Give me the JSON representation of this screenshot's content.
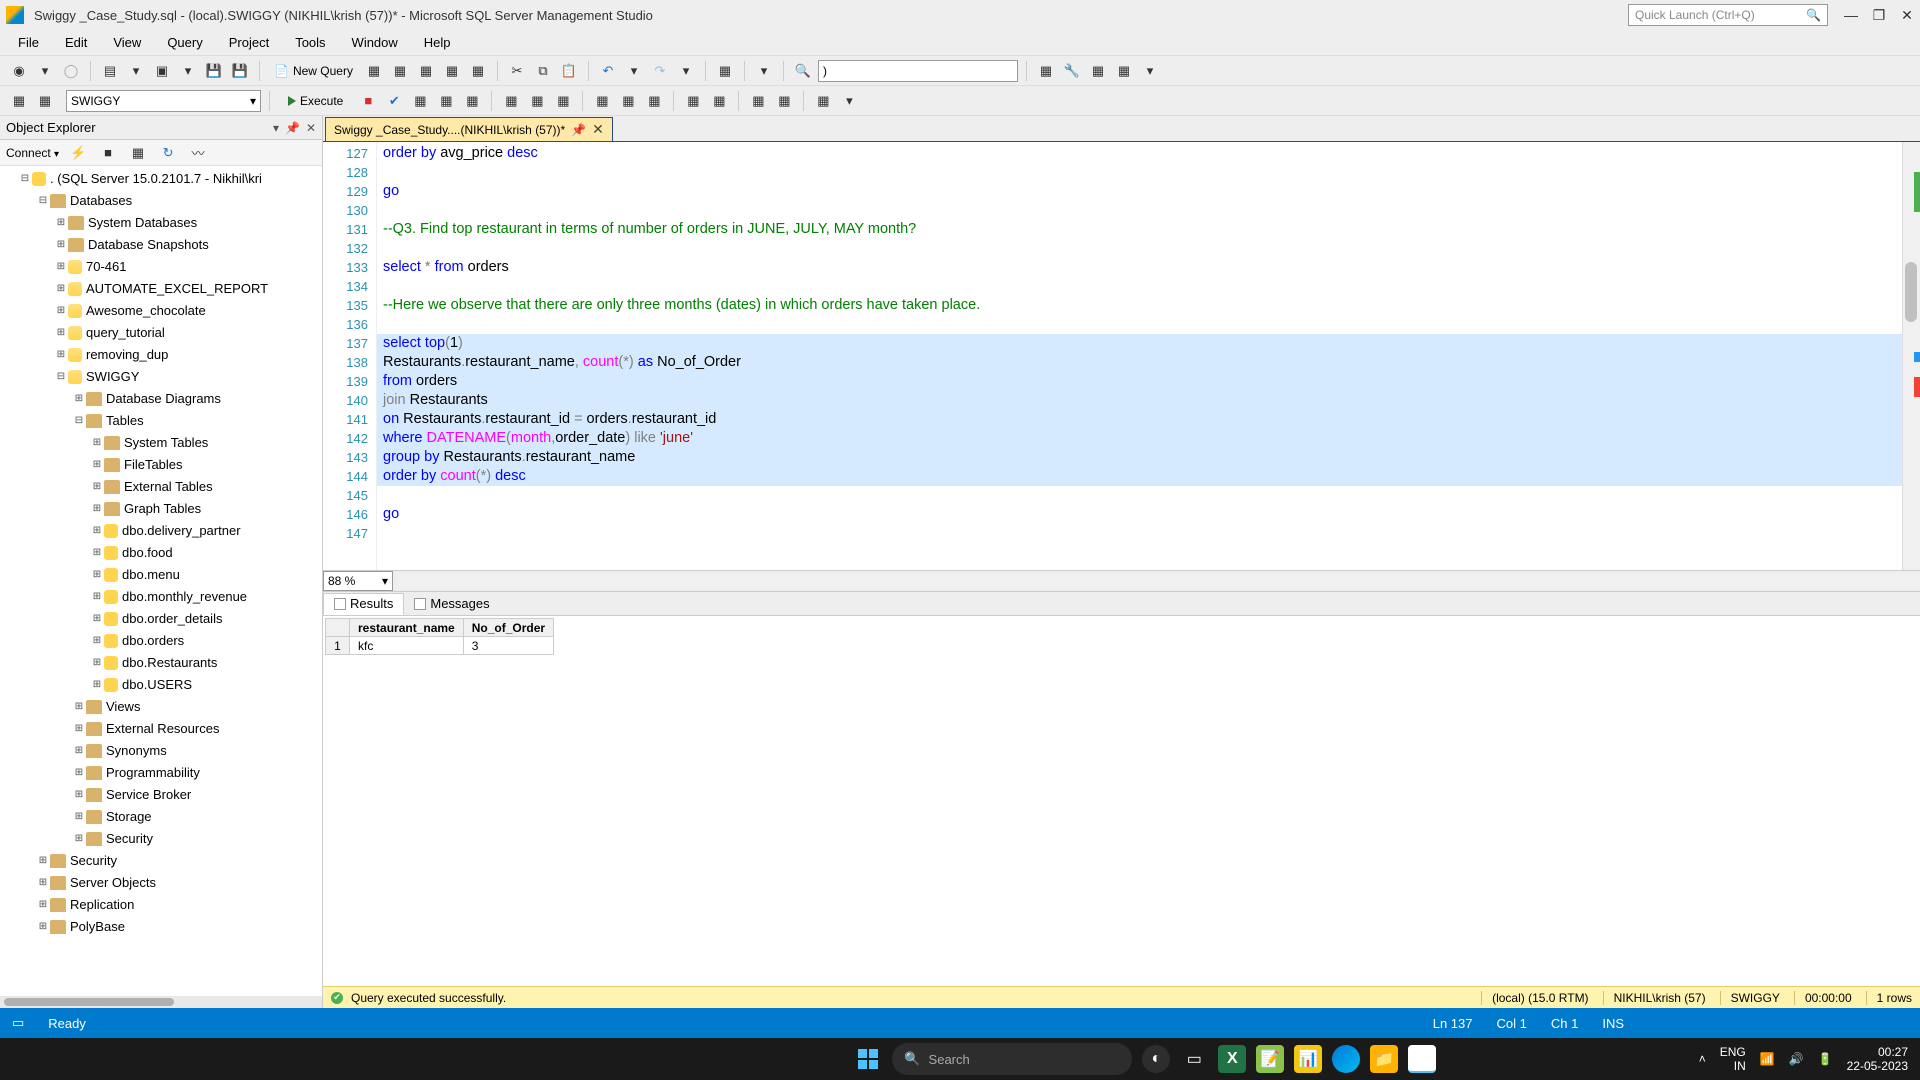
{
  "titlebar": {
    "text": "Swiggy _Case_Study.sql - (local).SWIGGY (NIKHIL\\krish (57))* - Microsoft SQL Server Management Studio",
    "quick_launch_placeholder": "Quick Launch (Ctrl+Q)"
  },
  "menu": [
    "File",
    "Edit",
    "View",
    "Query",
    "Project",
    "Tools",
    "Window",
    "Help"
  ],
  "toolbar": {
    "new_query": "New Query",
    "db": "SWIGGY",
    "execute": "Execute",
    "search_value": ")",
    "zoom": "88 %"
  },
  "object_explorer": {
    "title": "Object Explorer",
    "connect": "Connect",
    "tree": [
      {
        "depth": 0,
        "exp": "-",
        "icon": "db",
        "label": ". (SQL Server 15.0.2101.7 - Nikhil\\kri"
      },
      {
        "depth": 1,
        "exp": "-",
        "icon": "folder",
        "label": "Databases"
      },
      {
        "depth": 2,
        "exp": "+",
        "icon": "folder",
        "label": "System Databases"
      },
      {
        "depth": 2,
        "exp": "+",
        "icon": "folder",
        "label": "Database Snapshots"
      },
      {
        "depth": 2,
        "exp": "+",
        "icon": "cyl",
        "label": "70-461"
      },
      {
        "depth": 2,
        "exp": "+",
        "icon": "cyl",
        "label": "AUTOMATE_EXCEL_REPORT"
      },
      {
        "depth": 2,
        "exp": "+",
        "icon": "cyl",
        "label": "Awesome_chocolate"
      },
      {
        "depth": 2,
        "exp": "+",
        "icon": "cyl",
        "label": "query_tutorial"
      },
      {
        "depth": 2,
        "exp": "+",
        "icon": "cyl",
        "label": "removing_dup"
      },
      {
        "depth": 2,
        "exp": "-",
        "icon": "cyl",
        "label": "SWIGGY"
      },
      {
        "depth": 3,
        "exp": "+",
        "icon": "folder",
        "label": "Database Diagrams"
      },
      {
        "depth": 3,
        "exp": "-",
        "icon": "folder",
        "label": "Tables"
      },
      {
        "depth": 4,
        "exp": "+",
        "icon": "folder",
        "label": "System Tables"
      },
      {
        "depth": 4,
        "exp": "+",
        "icon": "folder",
        "label": "FileTables"
      },
      {
        "depth": 4,
        "exp": "+",
        "icon": "folder",
        "label": "External Tables"
      },
      {
        "depth": 4,
        "exp": "+",
        "icon": "folder",
        "label": "Graph Tables"
      },
      {
        "depth": 4,
        "exp": "+",
        "icon": "table",
        "label": "dbo.delivery_partner"
      },
      {
        "depth": 4,
        "exp": "+",
        "icon": "table",
        "label": "dbo.food"
      },
      {
        "depth": 4,
        "exp": "+",
        "icon": "table",
        "label": "dbo.menu"
      },
      {
        "depth": 4,
        "exp": "+",
        "icon": "table",
        "label": "dbo.monthly_revenue"
      },
      {
        "depth": 4,
        "exp": "+",
        "icon": "table",
        "label": "dbo.order_details"
      },
      {
        "depth": 4,
        "exp": "+",
        "icon": "table",
        "label": "dbo.orders"
      },
      {
        "depth": 4,
        "exp": "+",
        "icon": "table",
        "label": "dbo.Restaurants"
      },
      {
        "depth": 4,
        "exp": "+",
        "icon": "table",
        "label": "dbo.USERS"
      },
      {
        "depth": 3,
        "exp": "+",
        "icon": "folder",
        "label": "Views"
      },
      {
        "depth": 3,
        "exp": "+",
        "icon": "folder",
        "label": "External Resources"
      },
      {
        "depth": 3,
        "exp": "+",
        "icon": "folder",
        "label": "Synonyms"
      },
      {
        "depth": 3,
        "exp": "+",
        "icon": "folder",
        "label": "Programmability"
      },
      {
        "depth": 3,
        "exp": "+",
        "icon": "folder",
        "label": "Service Broker"
      },
      {
        "depth": 3,
        "exp": "+",
        "icon": "folder",
        "label": "Storage"
      },
      {
        "depth": 3,
        "exp": "+",
        "icon": "folder",
        "label": "Security"
      },
      {
        "depth": 1,
        "exp": "+",
        "icon": "folder",
        "label": "Security"
      },
      {
        "depth": 1,
        "exp": "+",
        "icon": "folder",
        "label": "Server Objects"
      },
      {
        "depth": 1,
        "exp": "+",
        "icon": "folder",
        "label": "Replication"
      },
      {
        "depth": 1,
        "exp": "+",
        "icon": "folder",
        "label": "PolyBase"
      }
    ]
  },
  "tab": {
    "label": "Swiggy _Case_Study....(NIKHIL\\krish (57))*"
  },
  "editor": {
    "first_line": 127,
    "highlight_from": 137,
    "highlight_to": 144,
    "lines": [
      [
        {
          "t": "order by",
          "c": "kw"
        },
        {
          "t": " avg_price ",
          "c": "id"
        },
        {
          "t": "desc",
          "c": "kw"
        }
      ],
      [],
      [
        {
          "t": "go",
          "c": "kw"
        }
      ],
      [],
      [
        {
          "t": "--Q3. Find top restaurant in terms of number of orders in JUNE, JULY, MAY month?",
          "c": "cmt"
        }
      ],
      [],
      [
        {
          "t": "select",
          "c": "kw"
        },
        {
          "t": " ",
          "c": "id"
        },
        {
          "t": "*",
          "c": "gray"
        },
        {
          "t": " ",
          "c": "id"
        },
        {
          "t": "from",
          "c": "kw"
        },
        {
          "t": " orders",
          "c": "id"
        }
      ],
      [],
      [
        {
          "t": "--Here we observe that there are only three months (dates) in which orders have taken place.",
          "c": "cmt"
        }
      ],
      [],
      [
        {
          "t": "select",
          "c": "kw"
        },
        {
          "t": " ",
          "c": "id"
        },
        {
          "t": "top",
          "c": "kw"
        },
        {
          "t": "(",
          "c": "gray"
        },
        {
          "t": "1",
          "c": "num"
        },
        {
          "t": ")",
          "c": "gray"
        }
      ],
      [
        {
          "t": "Restaurants",
          "c": "id"
        },
        {
          "t": ".",
          "c": "gray"
        },
        {
          "t": "restaurant_name",
          "c": "id"
        },
        {
          "t": ",",
          "c": "gray"
        },
        {
          "t": " ",
          "c": "id"
        },
        {
          "t": "count",
          "c": "fn"
        },
        {
          "t": "(",
          "c": "gray"
        },
        {
          "t": "*",
          "c": "gray"
        },
        {
          "t": ")",
          "c": "gray"
        },
        {
          "t": " ",
          "c": "id"
        },
        {
          "t": "as",
          "c": "kw"
        },
        {
          "t": " No_of_Order",
          "c": "id"
        }
      ],
      [
        {
          "t": "from",
          "c": "kw"
        },
        {
          "t": " orders",
          "c": "id"
        }
      ],
      [
        {
          "t": "join",
          "c": "gray"
        },
        {
          "t": " Restaurants",
          "c": "id"
        }
      ],
      [
        {
          "t": "on",
          "c": "kw"
        },
        {
          "t": " Restaurants",
          "c": "id"
        },
        {
          "t": ".",
          "c": "gray"
        },
        {
          "t": "restaurant_id ",
          "c": "id"
        },
        {
          "t": "=",
          "c": "gray"
        },
        {
          "t": " orders",
          "c": "id"
        },
        {
          "t": ".",
          "c": "gray"
        },
        {
          "t": "restaurant_id",
          "c": "id"
        }
      ],
      [
        {
          "t": "where",
          "c": "kw"
        },
        {
          "t": " ",
          "c": "id"
        },
        {
          "t": "DATENAME",
          "c": "fn"
        },
        {
          "t": "(",
          "c": "gray"
        },
        {
          "t": "month",
          "c": "fn"
        },
        {
          "t": ",",
          "c": "gray"
        },
        {
          "t": "order_date",
          "c": "id"
        },
        {
          "t": ")",
          "c": "gray"
        },
        {
          "t": " ",
          "c": "id"
        },
        {
          "t": "like",
          "c": "gray"
        },
        {
          "t": " ",
          "c": "id"
        },
        {
          "t": "'june'",
          "c": "str"
        }
      ],
      [
        {
          "t": "group",
          "c": "kw"
        },
        {
          "t": " ",
          "c": "id"
        },
        {
          "t": "by",
          "c": "kw"
        },
        {
          "t": " Restaurants",
          "c": "id"
        },
        {
          "t": ".",
          "c": "gray"
        },
        {
          "t": "restaurant_name",
          "c": "id"
        }
      ],
      [
        {
          "t": "order",
          "c": "kw"
        },
        {
          "t": " ",
          "c": "id"
        },
        {
          "t": "by",
          "c": "kw"
        },
        {
          "t": " ",
          "c": "id"
        },
        {
          "t": "count",
          "c": "fn"
        },
        {
          "t": "(",
          "c": "gray"
        },
        {
          "t": "*",
          "c": "gray"
        },
        {
          "t": ")",
          "c": "gray"
        },
        {
          "t": " ",
          "c": "id"
        },
        {
          "t": "desc",
          "c": "kw"
        }
      ],
      [],
      [
        {
          "t": "go",
          "c": "kw"
        }
      ],
      []
    ]
  },
  "results": {
    "tab_results": "Results",
    "tab_messages": "Messages",
    "columns": [
      "restaurant_name",
      "No_of_Order"
    ],
    "rows": [
      {
        "n": "1",
        "restaurant_name": "kfc",
        "No_of_Order": "3"
      }
    ]
  },
  "query_status": {
    "msg": "Query executed successfully.",
    "server": "(local) (15.0 RTM)",
    "user": "NIKHIL\\krish (57)",
    "db": "SWIGGY",
    "time": "00:00:00",
    "rows": "1 rows"
  },
  "ide_status": {
    "ready": "Ready",
    "ln": "Ln 137",
    "col": "Col 1",
    "ch": "Ch 1",
    "ins": "INS"
  },
  "taskbar": {
    "search_placeholder": "Search",
    "lang1": "ENG",
    "lang2": "IN",
    "time": "00:27",
    "date": "22-05-2023"
  }
}
